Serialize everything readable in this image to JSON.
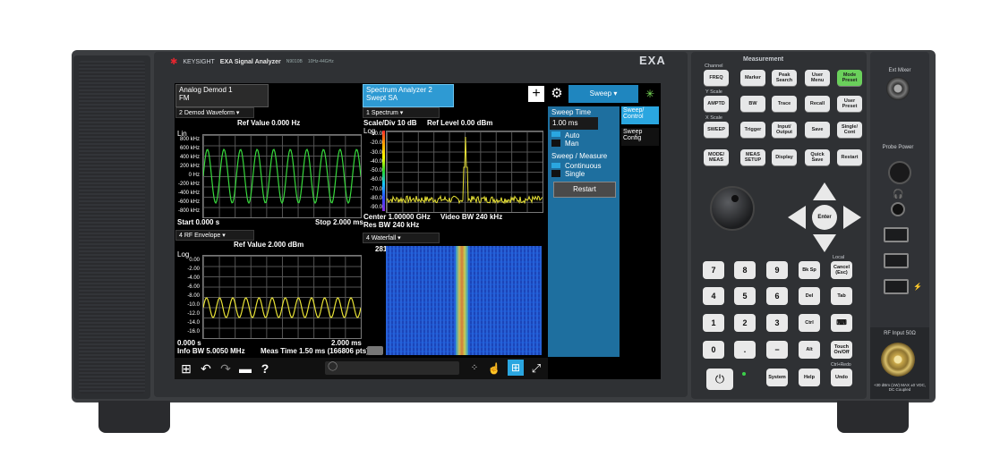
{
  "brand": {
    "logo": "KEYSIGHT",
    "model": "EXA Signal Analyzer",
    "part": "N9010B",
    "range": "10Hz-44GHz",
    "series": "EXA"
  },
  "screen": {
    "tabs": [
      {
        "line1": "Analog Demod 1",
        "line2": "FM"
      },
      {
        "line1": "Spectrum Analyzer 2",
        "line2": "Swept SA"
      }
    ],
    "sweep_label": "Sweep",
    "left_top": {
      "dropdown": "2 Demod Waveform",
      "ref": "Ref Value 0.000 Hz",
      "scale": "Lin",
      "yticks": [
        "800 kHz",
        "600 kHz",
        "400 kHz",
        "200 kHz",
        "0 Hz",
        "-200 kHz",
        "-400 kHz",
        "-600 kHz",
        "-800 kHz"
      ],
      "start": "Start 0.000 s",
      "stop": "Stop 2.000 ms"
    },
    "left_bottom": {
      "dropdown": "4 RF Envelope",
      "ref": "Ref Value 2.000 dBm",
      "scale": "Log",
      "yticks": [
        "0.00",
        "-2.00",
        "-4.00",
        "-6.00",
        "-8.00",
        "-10.0",
        "-12.0",
        "-14.0",
        "-16.0"
      ],
      "start": "0.000 s",
      "stop": "2.000 ms",
      "info": "Info BW 5.0050 MHz",
      "meas": "Meas Time 1.50 ms (166806 pts)"
    },
    "spectrum": {
      "dropdown": "1 Spectrum",
      "scale": "Scale/Div 10 dB",
      "ref": "Ref Level 0.00 dBm",
      "log": "Log",
      "yticks": [
        "-10.0",
        "-20.0",
        "-30.0",
        "-40.0",
        "-50.0",
        "-60.0",
        "-70.0",
        "-80.0",
        "-90.0"
      ],
      "center": "Center 1.00000 GHz",
      "vbw": "Video BW 240 kHz",
      "rbw": "Res BW 240 kHz"
    },
    "waterfall": {
      "dropdown": "4 Waterfall",
      "count": "281"
    },
    "sweep_panel": {
      "title": "Sweep Time",
      "value": "1.00 ms",
      "auto": "Auto",
      "man": "Man",
      "measure": "Sweep / Measure",
      "continuous": "Continuous",
      "single": "Single",
      "restart": "Restart"
    },
    "side_tabs": [
      "Sweep/ Control",
      "Sweep Config"
    ]
  },
  "keys": {
    "measurement_label": "Measurement",
    "channel_label": "Channel",
    "yscale_label": "Y Scale",
    "xscale_label": "X Scale",
    "freq": "FREQ",
    "amptd": "AMPTD",
    "sweep": "SWEEP",
    "mode_meas": "MODE/ MEAS",
    "marker": "Marker",
    "peak": "Peak Search",
    "user_menu": "User Menu",
    "mode_preset": "Mode Preset",
    "bw": "BW",
    "trace": "Trace",
    "recall": "Recall",
    "user_preset": "User Preset",
    "trigger": "Trigger",
    "input": "Input/ Output",
    "save": "Save",
    "single": "Single/ Cont",
    "meas_setup": "MEAS SETUP",
    "display": "Display",
    "quick_save": "Quick Save",
    "restart": "Restart",
    "enter": "Enter",
    "local": "Local",
    "numpad": [
      "7",
      "8",
      "9",
      "4",
      "5",
      "6",
      "1",
      "2",
      "3",
      "0",
      ".",
      "−"
    ],
    "bksp": "Bk Sp",
    "cancel": "Cancel (Esc)",
    "del": "Del",
    "tab": "Tab",
    "ctrl": "Ctrl",
    "alt": "Alt",
    "touch": "Touch On/Off",
    "system": "System",
    "help": "Help",
    "undo": "Undo",
    "undo_label": "Ctrl+Redo"
  },
  "right": {
    "ext_mixer": "Ext Mixer",
    "probe": "Probe Power",
    "rf_input": "RF Input 50Ω",
    "warning": "+30 dBm (1W) MAX ±0 VDC, DC Coupled"
  }
}
